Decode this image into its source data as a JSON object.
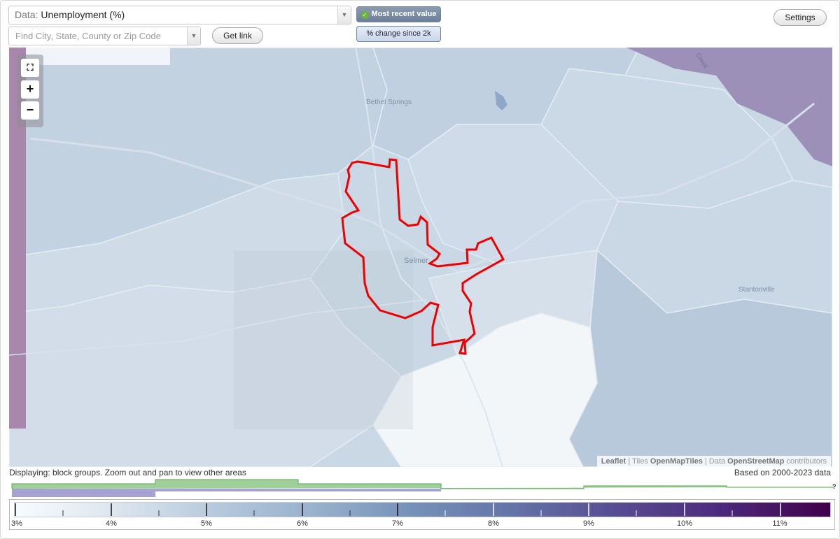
{
  "toolbar": {
    "data_prefix": "Data:",
    "data_value": "Unemployment (%)",
    "search_placeholder": "Find City, State, County or Zip Code",
    "get_link_label": "Get link",
    "most_recent_label": "Most recent value",
    "pct_change_label": "% change since 2k",
    "settings_label": "Settings"
  },
  "map": {
    "place_labels": [
      "Bethel Springs",
      "Selmer",
      "Stantonville"
    ],
    "road_label": "Creek",
    "attribution": {
      "leaflet": "Leaflet",
      "sep1": " | Tiles ",
      "tiles": "OpenMapTiles",
      "sep2": " | Data ",
      "data": "OpenStreetMap",
      "suffix": " contributors"
    },
    "boundary_color": "#ee0000"
  },
  "status": {
    "displaying": "Displaying: block groups. Zoom out and pan to view other areas",
    "based_on": "Based on 2000-2023 data",
    "unknown_mark": "?"
  },
  "legend": {
    "tick_labels": [
      "3%",
      "4%",
      "5%",
      "6%",
      "7%",
      "8%",
      "9%",
      "10%",
      "11%"
    ],
    "colors": [
      "#f7fbff",
      "#dde6ef",
      "#b5c8dc",
      "#97b0cc",
      "#7590b8",
      "#6574a8",
      "#584f93",
      "#4d2c7d",
      "#40004c"
    ]
  }
}
